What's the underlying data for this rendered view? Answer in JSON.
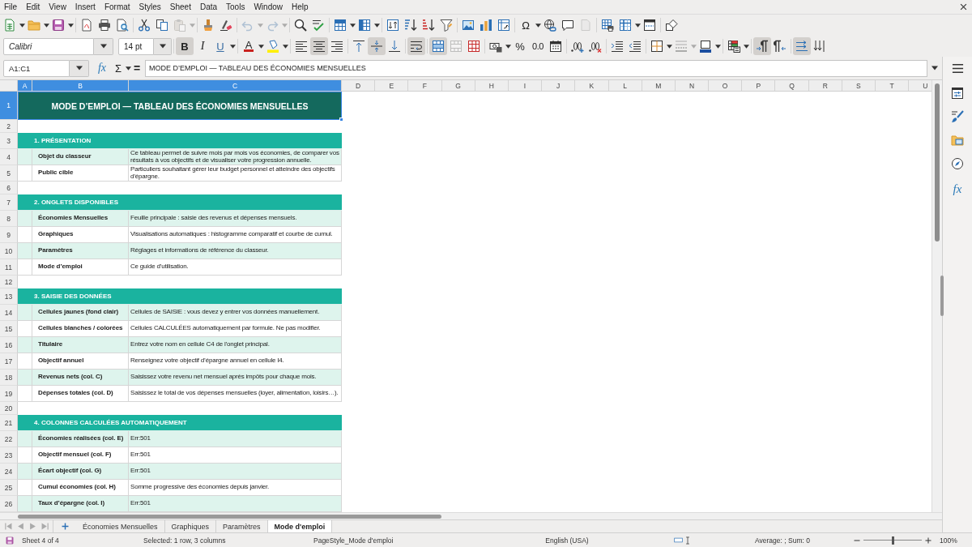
{
  "menu_bar": {
    "items": [
      "File",
      "Edit",
      "View",
      "Insert",
      "Format",
      "Styles",
      "Sheet",
      "Data",
      "Tools",
      "Window",
      "Help"
    ]
  },
  "standard_toolbar": {
    "special_character_glyph": "Ω",
    "paste_disabled": true,
    "undo_disabled": true,
    "redo_disabled": true,
    "headers_footers_disabled": true
  },
  "formatting_toolbar": {
    "font_name": "Calibri",
    "font_size": "14 pt",
    "style_buttons": [
      {
        "glyph": "B",
        "pressed": true
      },
      {
        "glyph": "I",
        "pressed": false
      },
      {
        "glyph": "U",
        "pressed": false
      }
    ],
    "font_color_glyph": "A",
    "align_left": false,
    "align_center": true,
    "align_right": false,
    "align_top": false,
    "align_middle": true,
    "align_bottom": false,
    "wrap_text": true,
    "merge_and_center": true,
    "merge_cells_disabled": true,
    "percent_glyph": "%",
    "decimal_glyph": "0.0",
    "border_style_disabled": true,
    "left_to_right": true,
    "right_to_left": false,
    "text_horizontal": true,
    "text_vertical": false
  },
  "formula_bar": {
    "name_box": "A1:C1",
    "function_glyph": "fx",
    "sum_glyph": "Σ",
    "equals_glyph": "=",
    "content": "MODE D’EMPLOI — TABLEAU DES ÉCONOMIES MENSUELLES"
  },
  "sheet": {
    "columns": [
      {
        "label": "A",
        "selected": true
      },
      {
        "label": "B",
        "selected": true
      },
      {
        "label": "C",
        "selected": true
      },
      {
        "label": "D",
        "selected": false
      },
      {
        "label": "E",
        "selected": false
      },
      {
        "label": "F",
        "selected": false
      },
      {
        "label": "G",
        "selected": false
      },
      {
        "label": "H",
        "selected": false
      },
      {
        "label": "I",
        "selected": false
      },
      {
        "label": "J",
        "selected": false
      },
      {
        "label": "K",
        "selected": false
      },
      {
        "label": "L",
        "selected": false
      },
      {
        "label": "M",
        "selected": false
      },
      {
        "label": "N",
        "selected": false
      },
      {
        "label": "O",
        "selected": false
      },
      {
        "label": "P",
        "selected": false
      },
      {
        "label": "Q",
        "selected": false
      },
      {
        "label": "R",
        "selected": false
      },
      {
        "label": "S",
        "selected": false
      },
      {
        "label": "T",
        "selected": false
      },
      {
        "label": "U",
        "selected": false
      }
    ],
    "rows": [
      {
        "number": "1",
        "kind": "title",
        "selected": true,
        "text": "MODE D’EMPLOI — TABLEAU DES ÉCONOMIES MENSUELLES"
      },
      {
        "number": "2",
        "kind": "blank",
        "selected": false
      },
      {
        "number": "3",
        "kind": "section",
        "selected": false,
        "text": "1. PRÉSENTATION"
      },
      {
        "number": "4",
        "kind": "entry",
        "selected": false,
        "shaded": true,
        "label": "Objet du classeur",
        "description": "Ce tableau permet de suivre mois par mois vos économies, de comparer vos résultats à vos objectifs et de visualiser votre progression annuelle."
      },
      {
        "number": "5",
        "kind": "entry",
        "selected": false,
        "shaded": false,
        "label": "Public cible",
        "description": "Particuliers souhaitant gérer leur budget personnel et atteindre des objectifs d’épargne."
      },
      {
        "number": "6",
        "kind": "blank",
        "selected": false
      },
      {
        "number": "7",
        "kind": "section",
        "selected": false,
        "text": "2. ONGLETS DISPONIBLES"
      },
      {
        "number": "8",
        "kind": "entry",
        "selected": false,
        "shaded": true,
        "label": "Économies Mensuelles",
        "description": "Feuille principale : saisie des revenus et dépenses mensuels."
      },
      {
        "number": "9",
        "kind": "entry",
        "selected": false,
        "shaded": false,
        "label": "Graphiques",
        "description": "Visualisations automatiques : histogramme comparatif et courbe de cumul."
      },
      {
        "number": "10",
        "kind": "entry",
        "selected": false,
        "shaded": true,
        "label": "Paramètres",
        "description": "Réglages et informations de référence du classeur."
      },
      {
        "number": "11",
        "kind": "entry",
        "selected": false,
        "shaded": false,
        "label": "Mode d’emploi",
        "description": "Ce guide d’utilisation."
      },
      {
        "number": "12",
        "kind": "blank",
        "selected": false
      },
      {
        "number": "13",
        "kind": "section",
        "selected": false,
        "text": "3. SAISIE DES DONNÉES"
      },
      {
        "number": "14",
        "kind": "entry",
        "selected": false,
        "shaded": true,
        "label": "Cellules jaunes (fond clair)",
        "description": "Cellules de SAISIE : vous devez y entrer vos données manuellement."
      },
      {
        "number": "15",
        "kind": "entry",
        "selected": false,
        "shaded": false,
        "label": "Cellules blanches / colorées",
        "description": "Cellules CALCULÉES automatiquement par formule. Ne pas modifier."
      },
      {
        "number": "16",
        "kind": "entry",
        "selected": false,
        "shaded": true,
        "label": "Titulaire",
        "description": "Entrez votre nom en cellule C4 de l’onglet principal."
      },
      {
        "number": "17",
        "kind": "entry",
        "selected": false,
        "shaded": false,
        "label": "Objectif annuel",
        "description": "Renseignez votre objectif d’épargne annuel en cellule I4."
      },
      {
        "number": "18",
        "kind": "entry",
        "selected": false,
        "shaded": true,
        "label": "Revenus nets (col. C)",
        "description": "Saisissez votre revenu net mensuel après impôts pour chaque mois."
      },
      {
        "number": "19",
        "kind": "entry",
        "selected": false,
        "shaded": false,
        "label": "Dépenses totales (col. D)",
        "description": "Saisissez le total de vos dépenses mensuelles (loyer, alimentation, loisirs…)."
      },
      {
        "number": "20",
        "kind": "blank",
        "selected": false
      },
      {
        "number": "21",
        "kind": "section",
        "selected": false,
        "text": "4. COLONNES CALCULÉES AUTOMATIQUEMENT"
      },
      {
        "number": "22",
        "kind": "entry",
        "selected": false,
        "shaded": true,
        "label": "Économies réalisées (col. E)",
        "description": "Err:501"
      },
      {
        "number": "23",
        "kind": "entry",
        "selected": false,
        "shaded": false,
        "label": "Objectif mensuel (col. F)",
        "description": "Err:501"
      },
      {
        "number": "24",
        "kind": "entry",
        "selected": false,
        "shaded": true,
        "label": "Écart objectif (col. G)",
        "description": "Err:501"
      },
      {
        "number": "25",
        "kind": "entry",
        "selected": false,
        "shaded": false,
        "label": "Cumul économies (col. H)",
        "description": "Somme progressive des économies depuis janvier."
      },
      {
        "number": "26",
        "kind": "entry",
        "selected": false,
        "shaded": true,
        "label": "Taux d’épargne (col. I)",
        "description": "Err:501"
      }
    ]
  },
  "sheet_tabs": [
    {
      "label": "Économies Mensuelles",
      "selected": false
    },
    {
      "label": "Graphiques",
      "selected": false
    },
    {
      "label": "Paramètres",
      "selected": false
    },
    {
      "label": "Mode d'emploi",
      "selected": true
    }
  ],
  "status_bar": {
    "sheet": "Sheet 4 of 4",
    "selection": "Selected: 1 row, 3 columns",
    "page_style": "PageStyle_Mode d'emploi",
    "language": "English (USA)",
    "summary": "Average: ; Sum: 0",
    "zoom": {
      "level": 0.5,
      "reading": "100%"
    }
  },
  "sidebar": {
    "functions_glyph": "fx"
  }
}
